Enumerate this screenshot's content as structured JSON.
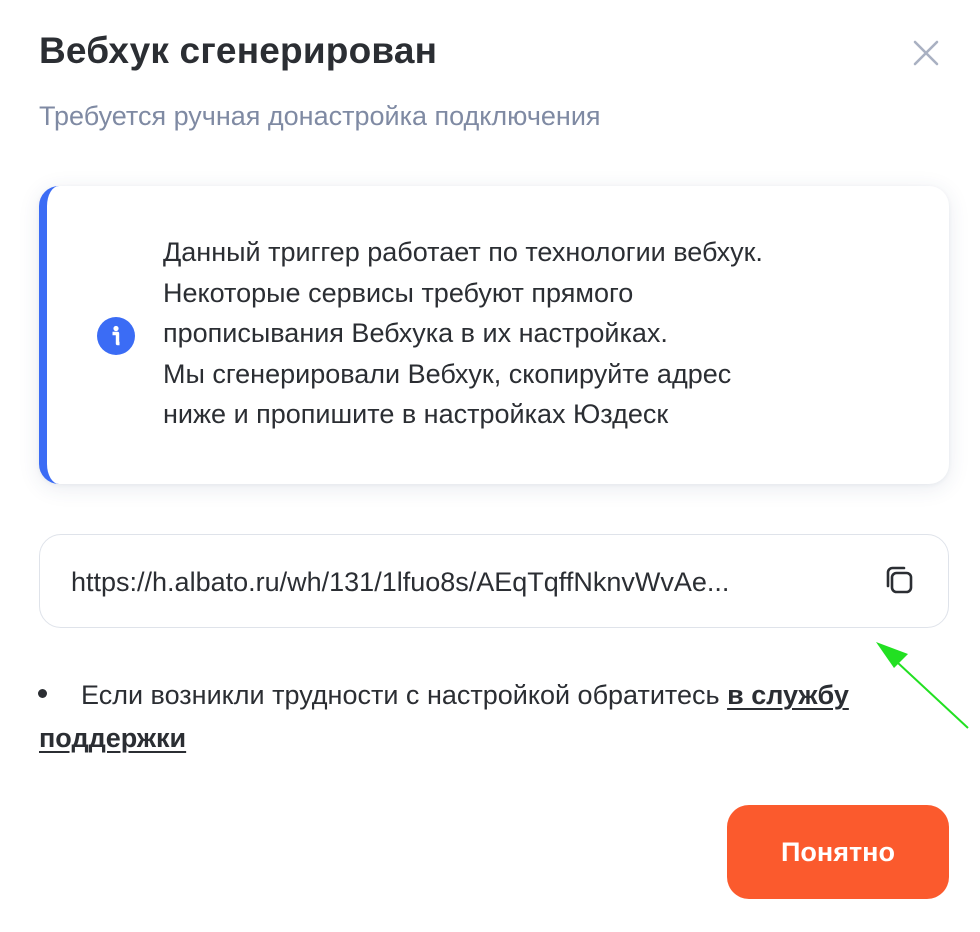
{
  "dialog": {
    "title": "Вебхук сгенерирован",
    "subtitle": "Требуется ручная донастройка подключения"
  },
  "info_card": {
    "accent_color": "#3b6cf5",
    "icon": "info-icon",
    "lines": [
      "Данный триггер работает по технологии вебхук.",
      "Некоторые сервисы требуют прямого",
      "прописывания Вебхука в их настройках.",
      "Мы сгенерировали Вебхук, скопируйте адрес",
      "ниже и пропишите в настройках Юздеск"
    ]
  },
  "webhook": {
    "url": "https://h.albato.ru/wh/131/1lfuo8s/AEqTqffNknvWvAe...",
    "copy_icon": "copy-icon"
  },
  "help": {
    "text": "Если возникли трудности с настройкой обратитесь",
    "link_text": "в службу поддержки"
  },
  "buttons": {
    "confirm_label": "Понятно",
    "confirm_color": "#fb5a2d",
    "close_icon": "close-icon"
  },
  "annotation": {
    "arrow_color": "#22e022"
  }
}
